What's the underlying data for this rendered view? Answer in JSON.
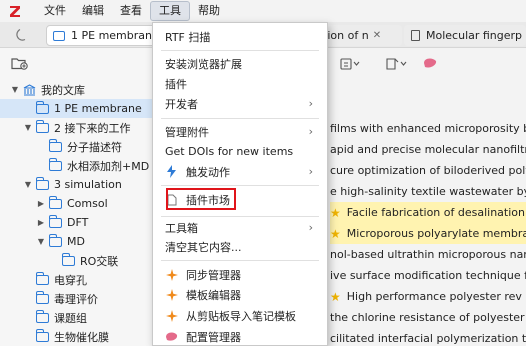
{
  "menubar": {
    "items": [
      "文件",
      "编辑",
      "查看",
      "工具",
      "帮助"
    ],
    "active": "工具"
  },
  "tabs": {
    "library_tab": "1 PE membrane",
    "tab2_label": "ction of n",
    "tab3_label": "Molecular fingerp"
  },
  "tree": [
    {
      "label": "我的文库"
    },
    {
      "label": "1 PE membrane"
    },
    {
      "label": "2 接下来的工作"
    },
    {
      "label": "分子描述符"
    },
    {
      "label": "水相添加剂+MD"
    },
    {
      "label": "3 simulation"
    },
    {
      "label": "Comsol"
    },
    {
      "label": "DFT"
    },
    {
      "label": "MD"
    },
    {
      "label": "RO交联"
    },
    {
      "label": "电穿孔"
    },
    {
      "label": "毒理评价"
    },
    {
      "label": "课题组"
    },
    {
      "label": "生物催化膜"
    }
  ],
  "items": [
    {
      "title": "films with enhanced microporosity b",
      "star": false
    },
    {
      "title": "apid and precise molecular nanofiltr",
      "star": false
    },
    {
      "title": "cure optimization of biloderived poly",
      "star": false
    },
    {
      "title": "e high-salinity textile wastewater by",
      "star": false
    },
    {
      "title": "Facile fabrication of desalination N",
      "star": true
    },
    {
      "title": "Microporous polyarylate membran",
      "star": true
    },
    {
      "title": "nol-based ultrathin microporous nan",
      "star": false
    },
    {
      "title": "ive surface modification technique fo",
      "star": false
    },
    {
      "title": "High performance polyester rev",
      "star": true
    },
    {
      "title": "the chlorine resistance of polyester",
      "star": false
    },
    {
      "title": "cilitated interfacial polymerization to",
      "star": false
    }
  ],
  "tools_menu": {
    "rtf_scan": "RTF 扫描",
    "install_browser_ext": "安装浏览器扩展",
    "plugins": "插件",
    "developer": "开发者",
    "manage_attachments": "管理附件",
    "get_dois": "Get DOIs for new items",
    "triggers": "触发动作",
    "plugin_market": "插件市场",
    "toolbox": "工具箱",
    "clear_main_content": "清空其它内容...",
    "sync_manager": "同步管理器",
    "template_editor": "模板编辑器",
    "import_note_template": "从剪贴板导入笔记模板",
    "config_manager": "配置管理器"
  },
  "colors": {
    "accent": "#2e7bd6",
    "highlight_box": "#e0141a",
    "logo_red": "#d82128",
    "star": "#f0b400"
  }
}
